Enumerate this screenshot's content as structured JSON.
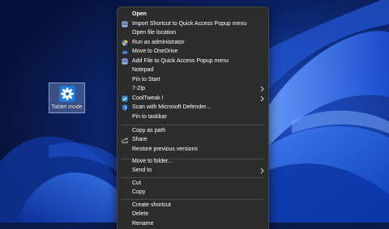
{
  "desktop": {
    "icon_label": "Tablet mode",
    "icon": "gear-icon"
  },
  "menu": {
    "items": [
      {
        "label": "Open",
        "icon": ""
      },
      {
        "label": "Import Shortcut to Quick Access Popup menu",
        "icon": "popup-menu-icon"
      },
      {
        "label": "Open file location",
        "icon": ""
      },
      {
        "label": "Run as administrator",
        "icon": "shield-icon"
      },
      {
        "label": "Move to OneDrive",
        "icon": "onedrive-cloud-icon"
      },
      {
        "label": "Add File to Quick Access Popup menu",
        "icon": "popup-menu-icon"
      },
      {
        "label": "Notepad",
        "icon": ""
      },
      {
        "label": "Pin to Start",
        "icon": ""
      },
      {
        "label": "7-Zip",
        "icon": "",
        "submenu": true
      },
      {
        "label": "CoolTweak !",
        "icon": "cooltweak-icon",
        "submenu": true
      },
      {
        "label": "Scan with Microsoft Defender...",
        "icon": "defender-icon"
      },
      {
        "label": "Pin to taskbar",
        "icon": ""
      },
      {
        "label": "Copy as path",
        "icon": ""
      },
      {
        "label": "Share",
        "icon": "share-icon"
      },
      {
        "label": "Restore previous versions",
        "icon": ""
      },
      {
        "label": "Move to folder...",
        "icon": ""
      },
      {
        "label": "Send to",
        "icon": "",
        "submenu": true
      },
      {
        "label": "Cut",
        "icon": ""
      },
      {
        "label": "Copy",
        "icon": ""
      },
      {
        "label": "Create shortcut",
        "icon": ""
      },
      {
        "label": "Delete",
        "icon": ""
      },
      {
        "label": "Rename",
        "icon": ""
      }
    ]
  },
  "colors": {
    "menu_bg": "#2c2c2c",
    "menu_text": "#ffffff",
    "separator": "#4a4a4a",
    "accent_blue": "#3a8ee6"
  }
}
